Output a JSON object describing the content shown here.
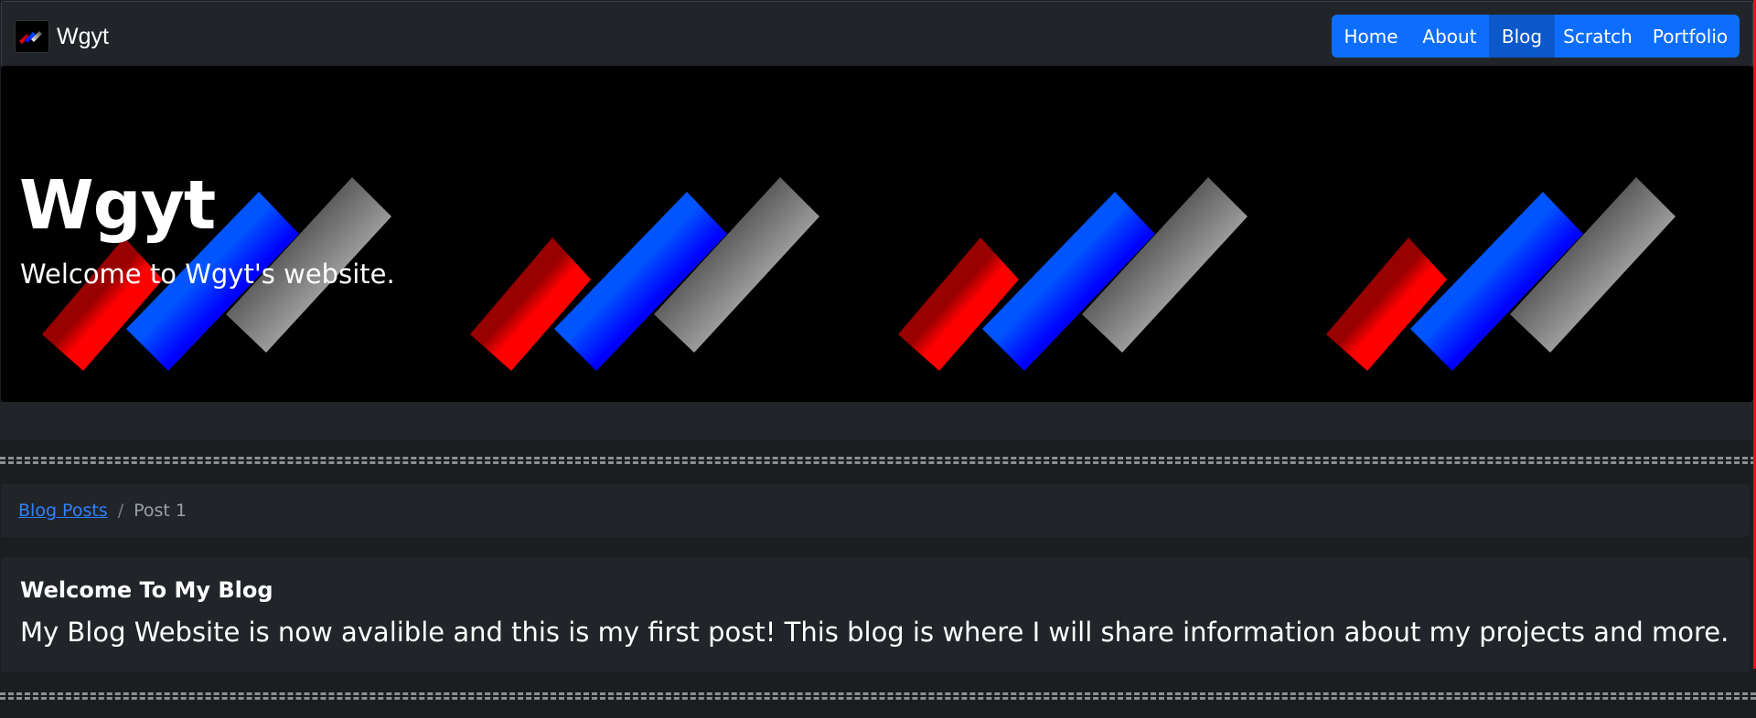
{
  "navbar": {
    "brand": "Wgyt",
    "links": [
      {
        "label": "Home",
        "active": false
      },
      {
        "label": "About",
        "active": false
      },
      {
        "label": "Blog",
        "active": true
      },
      {
        "label": "Scratch",
        "active": false
      },
      {
        "label": "Portfolio",
        "active": false
      }
    ]
  },
  "hero": {
    "title": "Wgyt",
    "subtitle": "Welcome to Wgyt's website."
  },
  "breadcrumb": {
    "parent": "Blog Posts",
    "separator": "/",
    "current": "Post 1"
  },
  "post": {
    "title": "Welcome To My Blog",
    "body": "My Blog Website is now avalible and this is my first post! This blog is where I will share information about my projects and more."
  },
  "colors": {
    "accent": "#0d6efd",
    "accent_active": "#0a58ca",
    "link": "#2f80ff",
    "panel": "#212529",
    "logo_red": "#ff0000",
    "logo_blue": "#0055ff",
    "logo_gray": "#555555"
  }
}
